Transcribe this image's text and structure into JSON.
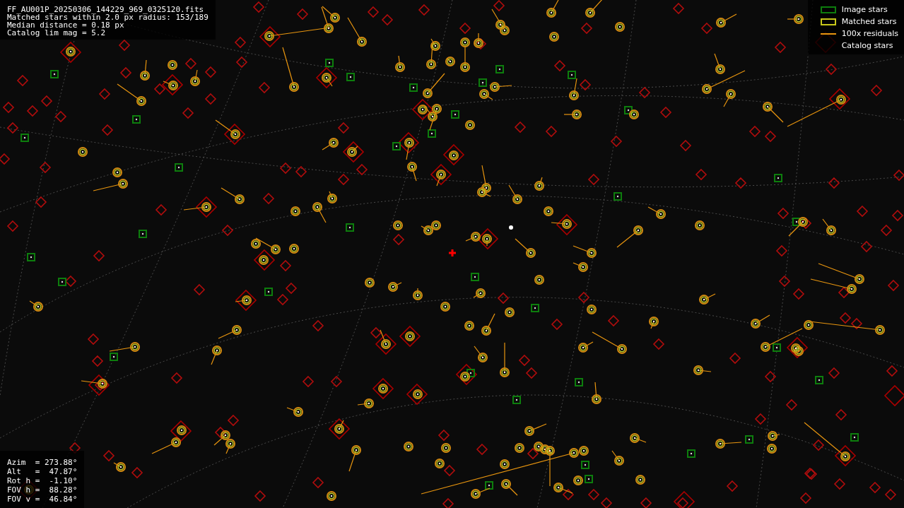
{
  "header": {
    "lines": [
      "FF_AU001P_20250306_144229_969_0325120.fits",
      "Matched stars within 2.0 px radius: 153/189",
      "Median distance = 0.18 px",
      "Catalog lim mag = 5.2"
    ]
  },
  "legend": [
    {
      "kind": "image",
      "label": "Image stars"
    },
    {
      "kind": "matched",
      "label": "Matched stars"
    },
    {
      "kind": "residual",
      "label": "100x residuals"
    },
    {
      "kind": "catalog",
      "label": "Catalog stars"
    }
  ],
  "pointing": {
    "lines": [
      "Azim  = 273.88°",
      "Alt   =  47.87°",
      "Rot h =  -1.10°",
      "FOV h =  88.28°",
      "FOV v =  46.84°"
    ]
  }
}
